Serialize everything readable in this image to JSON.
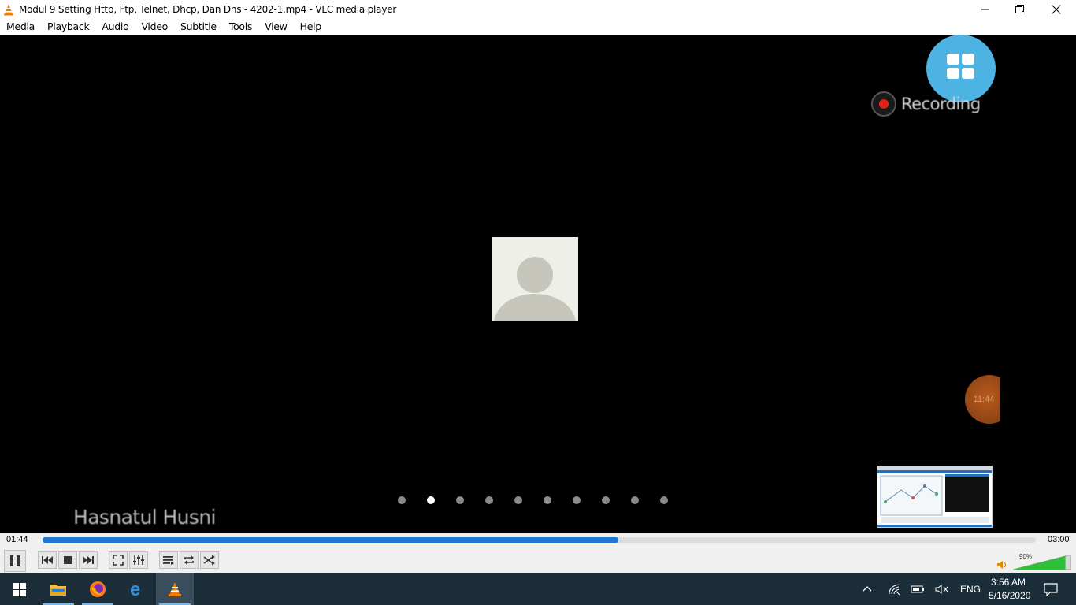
{
  "window": {
    "title": "Modul 9 Setting Http, Ftp, Telnet, Dhcp, Dan Dns - 4202-1.mp4 - VLC media player"
  },
  "menu": [
    {
      "label": "Media"
    },
    {
      "label": "Playback"
    },
    {
      "label": "Audio"
    },
    {
      "label": "Video"
    },
    {
      "label": "Subtitle"
    },
    {
      "label": "Tools"
    },
    {
      "label": "View"
    },
    {
      "label": "Help"
    }
  ],
  "video": {
    "recording_label": "Recording",
    "speaker_name": "Hasnatul Husni",
    "bubble_text": "11:44",
    "page_dots_count": 10,
    "active_dot_index": 1
  },
  "playback": {
    "current_time": "01:44",
    "total_time": "03:00",
    "progress_fraction": 0.58
  },
  "volume": {
    "percent_label": "90%",
    "level_fraction": 0.9
  },
  "taskbar": {
    "language": "ENG",
    "time": "3:56 AM",
    "date": "5/16/2020"
  },
  "colors": {
    "seek_fill": "#1e78d4",
    "recording_button": "#4db3e3",
    "recording_dot": "#e3201b",
    "volume_green": "#2fbf3a"
  }
}
